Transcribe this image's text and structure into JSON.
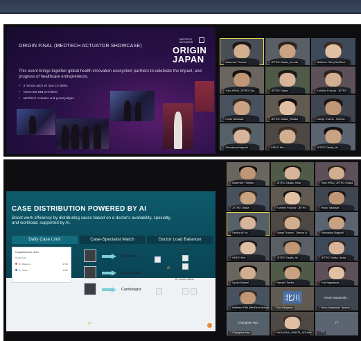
{
  "meeting1": {
    "slide": {
      "title": "ORIGIN FINAL (MEDTECH ACTUATOR SHOWCASE)",
      "brand_small": "MEDTECH\nACTUATOR",
      "brand_big_1": "ORIGIN",
      "brand_big_2": "JAPAN",
      "body": "This event brings together global health innovation ecosystem partners to celebrate the impact, and progress of healthcare entrepreneurs.",
      "bullets": [
        "3 minute pitch w/ max 10 slides",
        "Notes are not permitted",
        "MedTech Actuator and guest judges"
      ]
    },
    "participants": [
      {
        "name": "Makenzie Thomas",
        "active": true
      },
      {
        "name": "JETRO Osaka_Kuroda",
        "active": false
      },
      {
        "name": "Matthew Frith (MedTech...",
        "active": false
      },
      {
        "name": "Yuko HIRAI_JETRO Osa...",
        "active": false
      },
      {
        "name": "JETRO Osaka",
        "active": false
      },
      {
        "name": "Kunihiro Fukuda / JETRO",
        "active": false
      },
      {
        "name": "Hiroki Takizawa",
        "active": false
      },
      {
        "name": "JETRO Osaka_Tanaka",
        "active": false
      },
      {
        "name": "Sampt Travers - Deniva...",
        "active": false
      },
      {
        "name": "Shinobusa Noguchi",
        "active": false
      },
      {
        "name": "KEIKO Kim",
        "active": false
      },
      {
        "name": "JETRO Osaka_Ito",
        "active": false
      }
    ]
  },
  "meeting2": {
    "slide": {
      "title": "CASE DISTRIBUTION POWERED BY AI",
      "subtitle": "Boost work efficiency by distributing cases based on a doctor's availability, specialty, and workload, supported by AI.",
      "tabs": [
        "Daily Case Limit",
        "Case-Specialist Match",
        "Doctor Load Balancer"
      ],
      "panel_title": "Hospital Access Limits",
      "panel_sub": "Cardiologist",
      "panel_rows": [
        {
          "label": "Dr. Patterson",
          "value": "27/30"
        },
        {
          "label": "Dr. Jones",
          "value": "30/30"
        }
      ],
      "specialists": [
        "Physician",
        "Neurologist",
        "Cardiologist"
      ],
      "ai_label": "AI",
      "ai_label_2": "AI",
      "load_1": "Dr. Jon: 30min",
      "load_2": "Dr. Jones: 30min"
    },
    "participants": [
      {
        "name": "Makenzie Thomas",
        "active": false
      },
      {
        "name": "JETRO Osaka_Hara",
        "active": false
      },
      {
        "name": "Yuko HIRAI_JETRO Osaka",
        "active": false
      },
      {
        "name": "JETRO Osaka",
        "active": false
      },
      {
        "name": "Kunihiro Fukuda / JETRO",
        "active": false
      },
      {
        "name": "Hiroki Takizawa",
        "active": false
      },
      {
        "name": "Deniva AI Inc.",
        "active": true
      },
      {
        "name": "Sampt Travers - Deniva AI",
        "active": false
      },
      {
        "name": "Shinobusa Noguchi",
        "active": false
      },
      {
        "name": "KEIKO Kim",
        "active": false
      },
      {
        "name": "JETRO Osaka_Ito",
        "active": false
      },
      {
        "name": "JETRO Osaka_Ikeda",
        "active": false
      },
      {
        "name": "Kyoko Minami",
        "active": false
      },
      {
        "name": "Nanami Tomita",
        "active": false
      },
      {
        "name": "Yuki Nagasawa",
        "active": false
      },
      {
        "name": "Matthew Frith (MedTech Actuator)",
        "active": false
      },
      {
        "name": "Ryo Kitagawa",
        "active": false
      },
      {
        "name": "Revic Masatoshi Takatori",
        "active": false
      },
      {
        "name": "Changhee Han",
        "active": false
      },
      {
        "name": "NAGAOKA_SHINTA_SOUMA",
        "active": false
      },
      {
        "name": "TT",
        "active": false
      }
    ],
    "kanji_label": "北川",
    "revic_big": "Revic Masatoshi...",
    "changhee_big": "Changhee Han",
    "tt_big": "TT"
  }
}
